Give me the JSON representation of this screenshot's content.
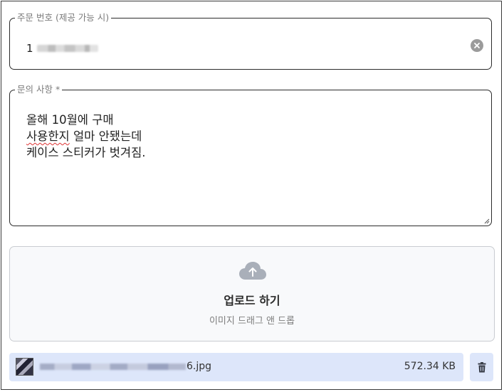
{
  "order_field": {
    "legend": "주문 번호 (제공 가능 시)",
    "value_prefix": "1"
  },
  "inquiry_field": {
    "legend": "문의 사항 *",
    "lines": [
      "올해 10월에 구매",
      "사용한지 얼마 안됐는데",
      "케이스 스티커가 벗겨짐."
    ],
    "misspelled_word": "사용한지",
    "line2_rest": " 얼마 안됐는데"
  },
  "upload": {
    "title": "업로드 하기",
    "subtitle": "이미지 드래그 앤 드롭",
    "icon": "cloud-upload-icon"
  },
  "file": {
    "name_suffix": "6.jpg",
    "size": "572.34 KB",
    "delete_icon": "trash-icon"
  },
  "colors": {
    "file_row_bg": "#dde6fa",
    "upload_bg": "#f8f9fb",
    "clear_icon": "#9b9b9b"
  }
}
